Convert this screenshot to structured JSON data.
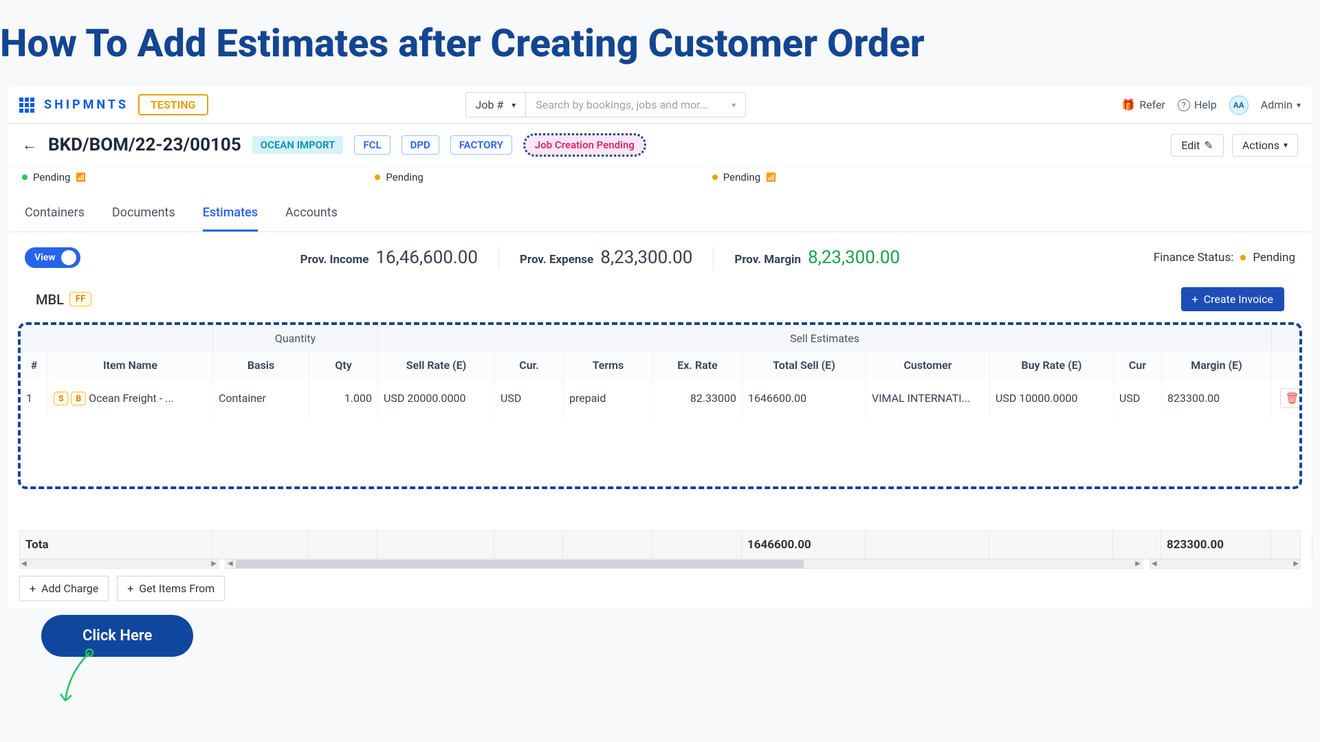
{
  "page_title": "How To Add Estimates after Creating Customer Order",
  "topbar": {
    "brand": "SHIPMNTS",
    "testing": "TESTING",
    "job_select": "Job #",
    "search_placeholder": "Search by bookings, jobs and mor...",
    "refer": "Refer",
    "help": "Help",
    "avatar": "AA",
    "admin": "Admin"
  },
  "header": {
    "order_id": "BKD/BOM/22-23/00105",
    "chips": [
      "OCEAN IMPORT",
      "FCL",
      "DPD",
      "FACTORY"
    ],
    "job_status": "Job Creation Pending",
    "edit": "Edit",
    "actions": "Actions"
  },
  "status": {
    "s1": "Pending",
    "s2": "Pending",
    "s3": "Pending"
  },
  "tabs": [
    "Containers",
    "Documents",
    "Estimates",
    "Accounts"
  ],
  "active_tab": 2,
  "summary": {
    "view": "View",
    "income_label": "Prov. Income",
    "income": "16,46,600.00",
    "expense_label": "Prov. Expense",
    "expense": "8,23,300.00",
    "margin_label": "Prov. Margin",
    "margin": "8,23,300.00",
    "finance_label": "Finance Status:",
    "finance_val": "Pending"
  },
  "mbl": {
    "label": "MBL",
    "ff": "FF",
    "create_invoice": "Create Invoice"
  },
  "table": {
    "group_qty": "Quantity",
    "group_sell": "Sell Estimates",
    "cols": {
      "num": "#",
      "item": "Item Name",
      "basis": "Basis",
      "qty": "Qty",
      "sell_rate": "Sell Rate (E)",
      "cur": "Cur.",
      "terms": "Terms",
      "ex_rate": "Ex. Rate",
      "total_sell": "Total Sell (E)",
      "customer": "Customer",
      "buy_rate": "Buy Rate (E)",
      "cur2": "Cur",
      "margin": "Margin (E)"
    },
    "rows": [
      {
        "num": "1",
        "item": "Ocean Freight - ...",
        "basis": "Container",
        "qty": "1.000",
        "sell_rate": "USD 20000.0000",
        "cur": "USD",
        "terms": "prepaid",
        "ex_rate": "82.33000",
        "total_sell": "1646600.00",
        "customer": "VIMAL INTERNATI...",
        "buy_rate": "USD 10000.0000",
        "cur2": "USD",
        "margin": "823300.00"
      }
    ],
    "totals": {
      "label": "Tota",
      "total_sell": "1646600.00",
      "margin": "823300.00"
    }
  },
  "callout": "Click Here",
  "bottom": {
    "add_charge": "Add Charge",
    "get_items": "Get Items From"
  }
}
